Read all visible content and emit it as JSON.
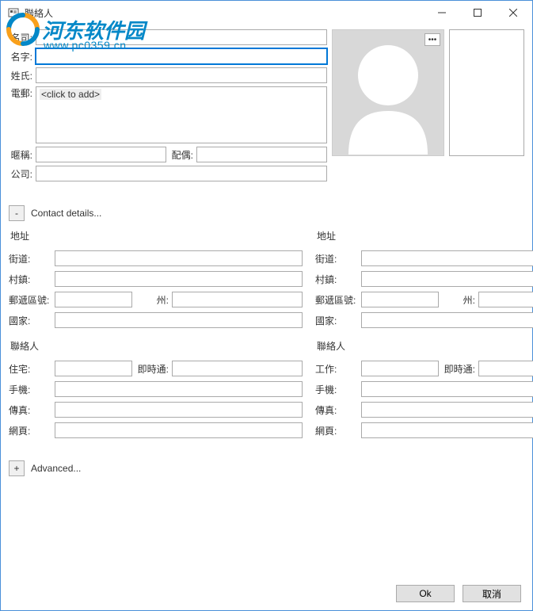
{
  "window": {
    "title": "聯絡人"
  },
  "watermark": {
    "text": "河东软件园",
    "url": "www.pc0359.cn"
  },
  "labels": {
    "name": "名司:",
    "firstname": "名字:",
    "lastname": "姓氏:",
    "email": "電郵:",
    "nickname": "暱稱:",
    "spouse": "配偶:",
    "company": "公司:"
  },
  "email_placeholder": "<click to add>",
  "sections": {
    "contact_details": "Contact details...",
    "advanced": "Advanced...",
    "collapse_symbol": "-",
    "expand_symbol": "+"
  },
  "address": {
    "header": "地址",
    "street": "街道:",
    "village": "村鎮:",
    "postal": "郵遞區號:",
    "state": "州:",
    "country": "國家:"
  },
  "contact": {
    "header": "聯絡人",
    "home": "住宅:",
    "work": "工作:",
    "im": "即時通:",
    "mobile": "手機:",
    "fax": "傳真:",
    "web": "網頁:"
  },
  "buttons": {
    "ok": "Ok",
    "cancel": "取消"
  },
  "values": {
    "name": "",
    "firstname": "",
    "lastname": "",
    "nickname": "",
    "spouse": "",
    "company": "",
    "addr1_street": "",
    "addr1_village": "",
    "addr1_postal": "",
    "addr1_state": "",
    "addr1_country": "",
    "addr2_street": "",
    "addr2_village": "",
    "addr2_postal": "",
    "addr2_state": "",
    "addr2_country": "",
    "c1_home": "",
    "c1_im": "",
    "c1_mobile": "",
    "c1_fax": "",
    "c1_web": "",
    "c2_work": "",
    "c2_im": "",
    "c2_mobile": "",
    "c2_fax": "",
    "c2_web": ""
  }
}
